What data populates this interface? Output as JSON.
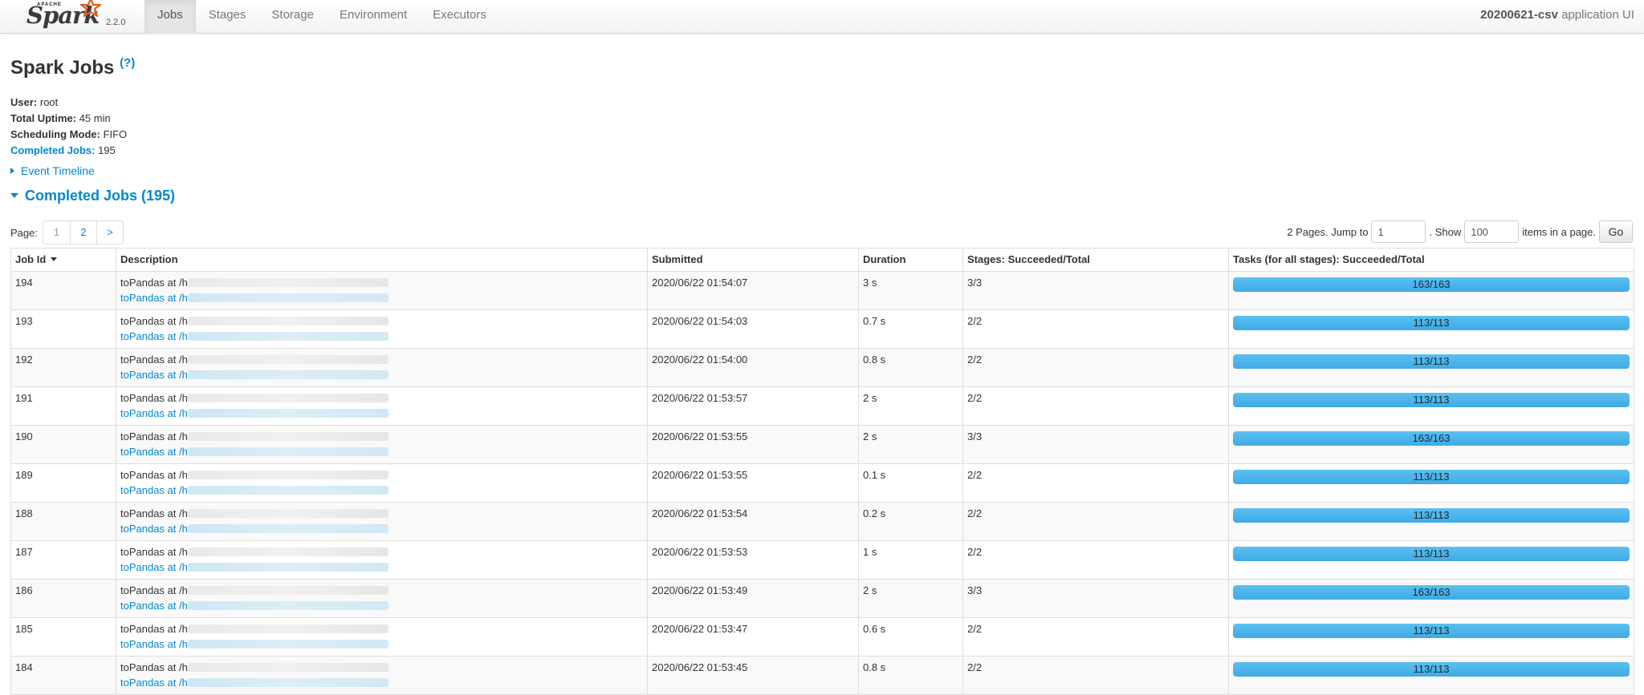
{
  "nav": {
    "brand_apache": "APACHE",
    "brand_name": "Spark",
    "version": "2.2.0",
    "tabs": [
      {
        "label": "Jobs",
        "active": true
      },
      {
        "label": "Stages",
        "active": false
      },
      {
        "label": "Storage",
        "active": false
      },
      {
        "label": "Environment",
        "active": false
      },
      {
        "label": "Executors",
        "active": false
      }
    ],
    "app_name": "20200621-csv",
    "app_suffix": " application UI"
  },
  "page": {
    "title": "Spark Jobs",
    "help_marker": "(?)"
  },
  "summary": {
    "user_label": "User:",
    "user_value": " root",
    "uptime_label": "Total Uptime:",
    "uptime_value": " 45 min",
    "mode_label": "Scheduling Mode:",
    "mode_value": " FIFO",
    "completed_label": "Completed Jobs:",
    "completed_value": " 195"
  },
  "event_timeline": "Event Timeline",
  "completed_heading": "Completed Jobs (195)",
  "pager": {
    "page_label": "Page:",
    "pages": [
      "1",
      "2",
      ">"
    ],
    "pages_text": "2 Pages. Jump to",
    "jump_value": "1",
    "show_text": ". Show",
    "show_value": "100",
    "items_text": "items in a page.",
    "go_label": "Go"
  },
  "table": {
    "headers": [
      "Job Id",
      "Description",
      "Submitted",
      "Duration",
      "Stages: Succeeded/Total",
      "Tasks (for all stages): Succeeded/Total"
    ],
    "desc_prefix": "toPandas at /h",
    "rows": [
      {
        "id": "194",
        "submitted": "2020/06/22 01:54:07",
        "duration": "3 s",
        "stages": "3/3",
        "tasks": "163/163",
        "progress": 1.0
      },
      {
        "id": "193",
        "submitted": "2020/06/22 01:54:03",
        "duration": "0.7 s",
        "stages": "2/2",
        "tasks": "113/113",
        "progress": 1.0
      },
      {
        "id": "192",
        "submitted": "2020/06/22 01:54:00",
        "duration": "0.8 s",
        "stages": "2/2",
        "tasks": "113/113",
        "progress": 1.0
      },
      {
        "id": "191",
        "submitted": "2020/06/22 01:53:57",
        "duration": "2 s",
        "stages": "2/2",
        "tasks": "113/113",
        "progress": 1.0
      },
      {
        "id": "190",
        "submitted": "2020/06/22 01:53:55",
        "duration": "2 s",
        "stages": "3/3",
        "tasks": "163/163",
        "progress": 1.0
      },
      {
        "id": "189",
        "submitted": "2020/06/22 01:53:55",
        "duration": "0.1 s",
        "stages": "2/2",
        "tasks": "113/113",
        "progress": 1.0
      },
      {
        "id": "188",
        "submitted": "2020/06/22 01:53:54",
        "duration": "0.2 s",
        "stages": "2/2",
        "tasks": "113/113",
        "progress": 1.0
      },
      {
        "id": "187",
        "submitted": "2020/06/22 01:53:53",
        "duration": "1 s",
        "stages": "2/2",
        "tasks": "113/113",
        "progress": 1.0
      },
      {
        "id": "186",
        "submitted": "2020/06/22 01:53:49",
        "duration": "2 s",
        "stages": "3/3",
        "tasks": "163/163",
        "progress": 1.0
      },
      {
        "id": "185",
        "submitted": "2020/06/22 01:53:47",
        "duration": "0.6 s",
        "stages": "2/2",
        "tasks": "113/113",
        "progress": 1.0
      },
      {
        "id": "184",
        "submitted": "2020/06/22 01:53:45",
        "duration": "0.8 s",
        "stages": "2/2",
        "tasks": "113/113",
        "progress": 1.0
      }
    ]
  },
  "colors": {
    "link": "#0088cc",
    "progress_fill": "#3eaae6",
    "navbar_bg": "#f2f2f2"
  },
  "icons": {
    "brand_logo": "spark-star-logo",
    "timeline_toggle": "triangle-right-icon",
    "completed_toggle": "triangle-down-icon",
    "sort": "sort-desc-icon"
  }
}
